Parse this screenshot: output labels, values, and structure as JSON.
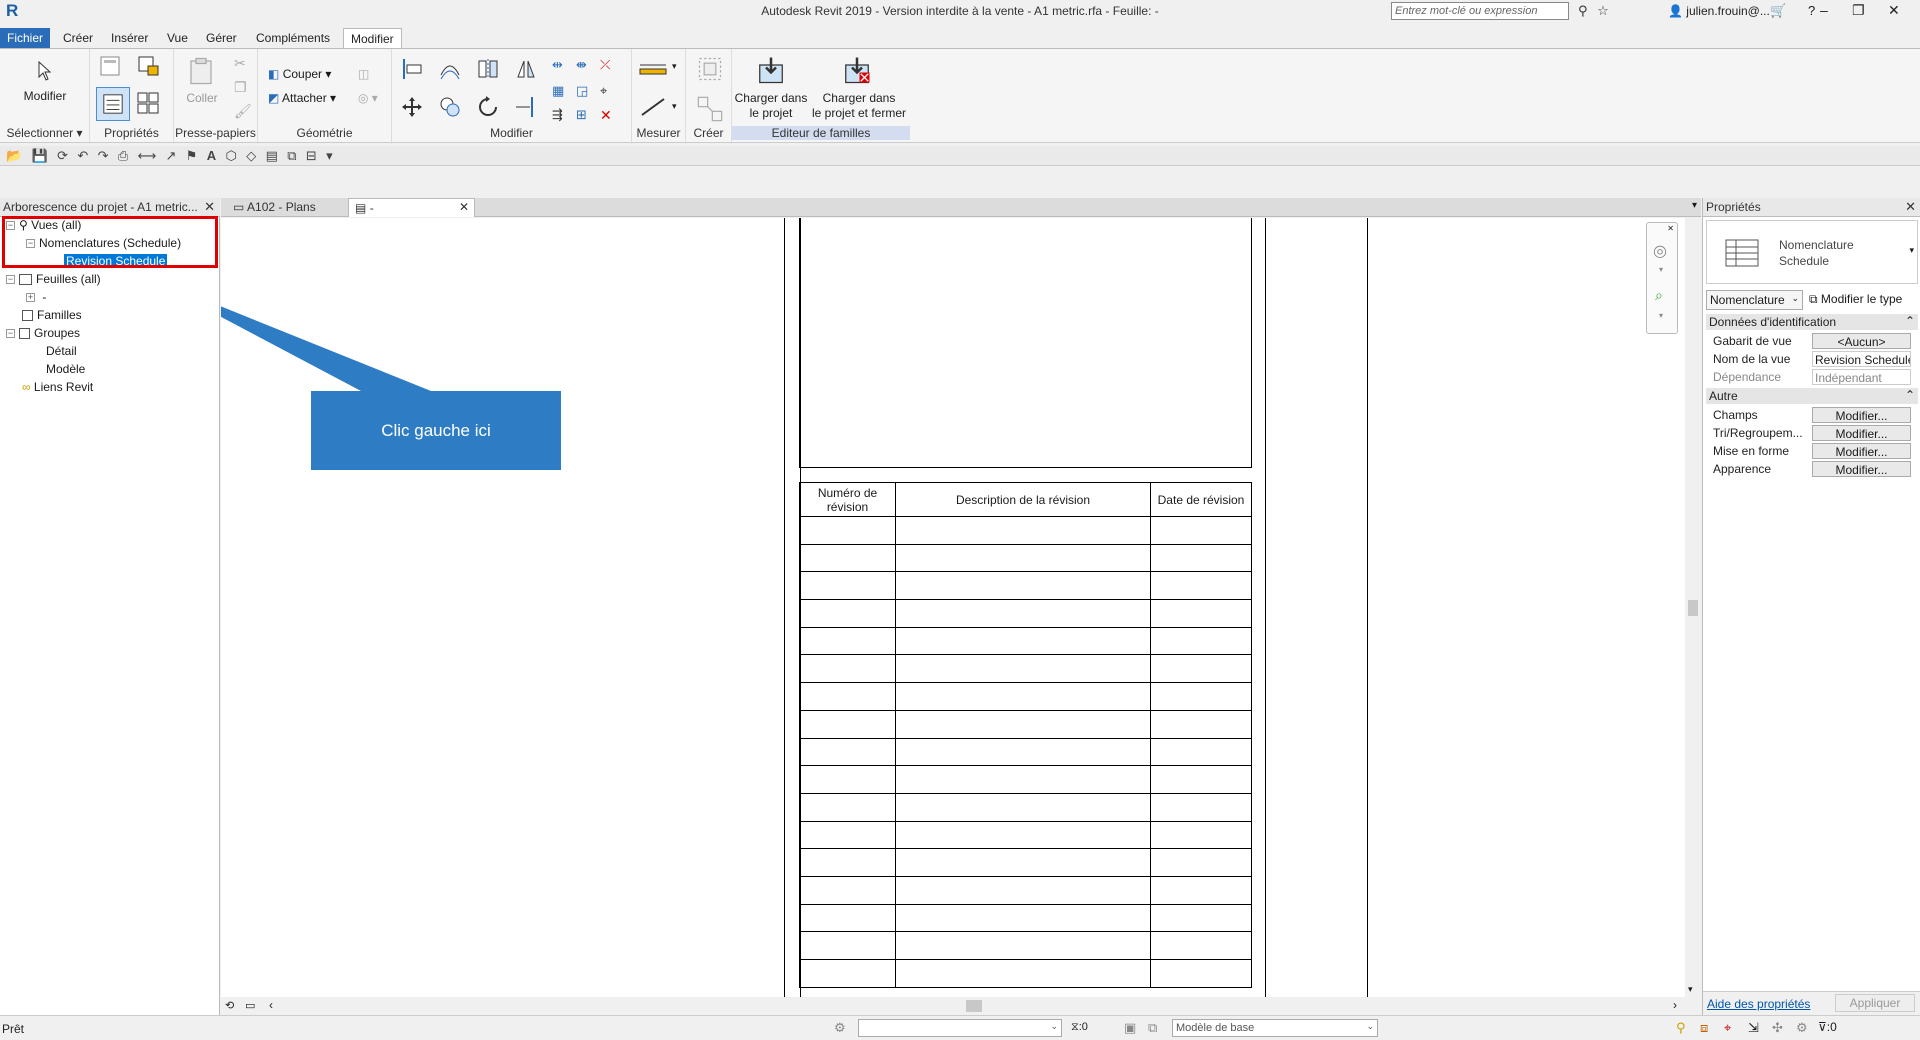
{
  "app": {
    "logo": "R",
    "title": "Autodesk Revit 2019 - Version interdite à la vente - A1 metric.rfa - Feuille:  -",
    "search_placeholder": "Entrez mot-clé ou expression",
    "user": "julien.frouin@..."
  },
  "menu_tabs": [
    "Fichier",
    "Créer",
    "Insérer",
    "Vue",
    "Gérer",
    "Compléments",
    "Modifier"
  ],
  "ribbon": {
    "modify_label": "Modifier",
    "panels": {
      "select": "Sélectionner",
      "properties": "Propriétés",
      "clipboard": "Presse-papiers",
      "geometry": "Géométrie",
      "modify": "Modifier",
      "measure": "Mesurer",
      "create": "Créer",
      "family_editor": "Editeur de familles"
    },
    "paste": "Coller",
    "cut": "Couper",
    "attach": "Attacher",
    "load_project_1": "Charger dans",
    "load_project_2": "le projet",
    "load_close_1": "Charger dans",
    "load_close_2": "le projet et fermer"
  },
  "browser": {
    "title": "Arborescence du projet - A1 metric...",
    "items": {
      "views": "Vues (all)",
      "schedules": "Nomenclatures (Schedule)",
      "revision_schedule": "Revision Schedule",
      "sheets": "Feuilles (all)",
      "sheet_dash": "-",
      "families": "Familles",
      "groups": "Groupes",
      "detail": "Détail",
      "model": "Modèle",
      "links": "Liens Revit"
    }
  },
  "doc_tabs": [
    "A102 - Plans",
    "-"
  ],
  "callout": "Clic gauche ici",
  "revision_table": {
    "headers": [
      "Numéro de révision",
      "Description de la révision",
      "Date de révision"
    ],
    "row_count": 17
  },
  "properties": {
    "title": "Propriétés",
    "type_name_1": "Nomenclature",
    "type_name_2": "Schedule",
    "instance_select": "Nomenclature",
    "edit_type": "Modifier le type",
    "group_identity": "Données d'identification",
    "rows_identity": [
      {
        "key": "Gabarit de vue",
        "value": "<Aucun>"
      },
      {
        "key": "Nom de la vue",
        "value": "Revision Schedule"
      },
      {
        "key": "Dépendance",
        "value": "Indépendant"
      }
    ],
    "group_other": "Autre",
    "rows_other": [
      {
        "key": "Champs",
        "value": "Modifier..."
      },
      {
        "key": "Tri/Regroupem...",
        "value": "Modifier..."
      },
      {
        "key": "Mise en forme",
        "value": "Modifier..."
      },
      {
        "key": "Apparence",
        "value": "Modifier..."
      }
    ],
    "help_link": "Aide des propriétés",
    "apply": "Appliquer"
  },
  "status": {
    "ready": "Prêt",
    "zero1": ":0",
    "model": "Modèle de base",
    "zero2": ":0"
  },
  "colors": {
    "accent": "#2b6cb8",
    "callout": "#2e7dc4",
    "highlight": "#e00000",
    "selection": "#0078d7"
  }
}
